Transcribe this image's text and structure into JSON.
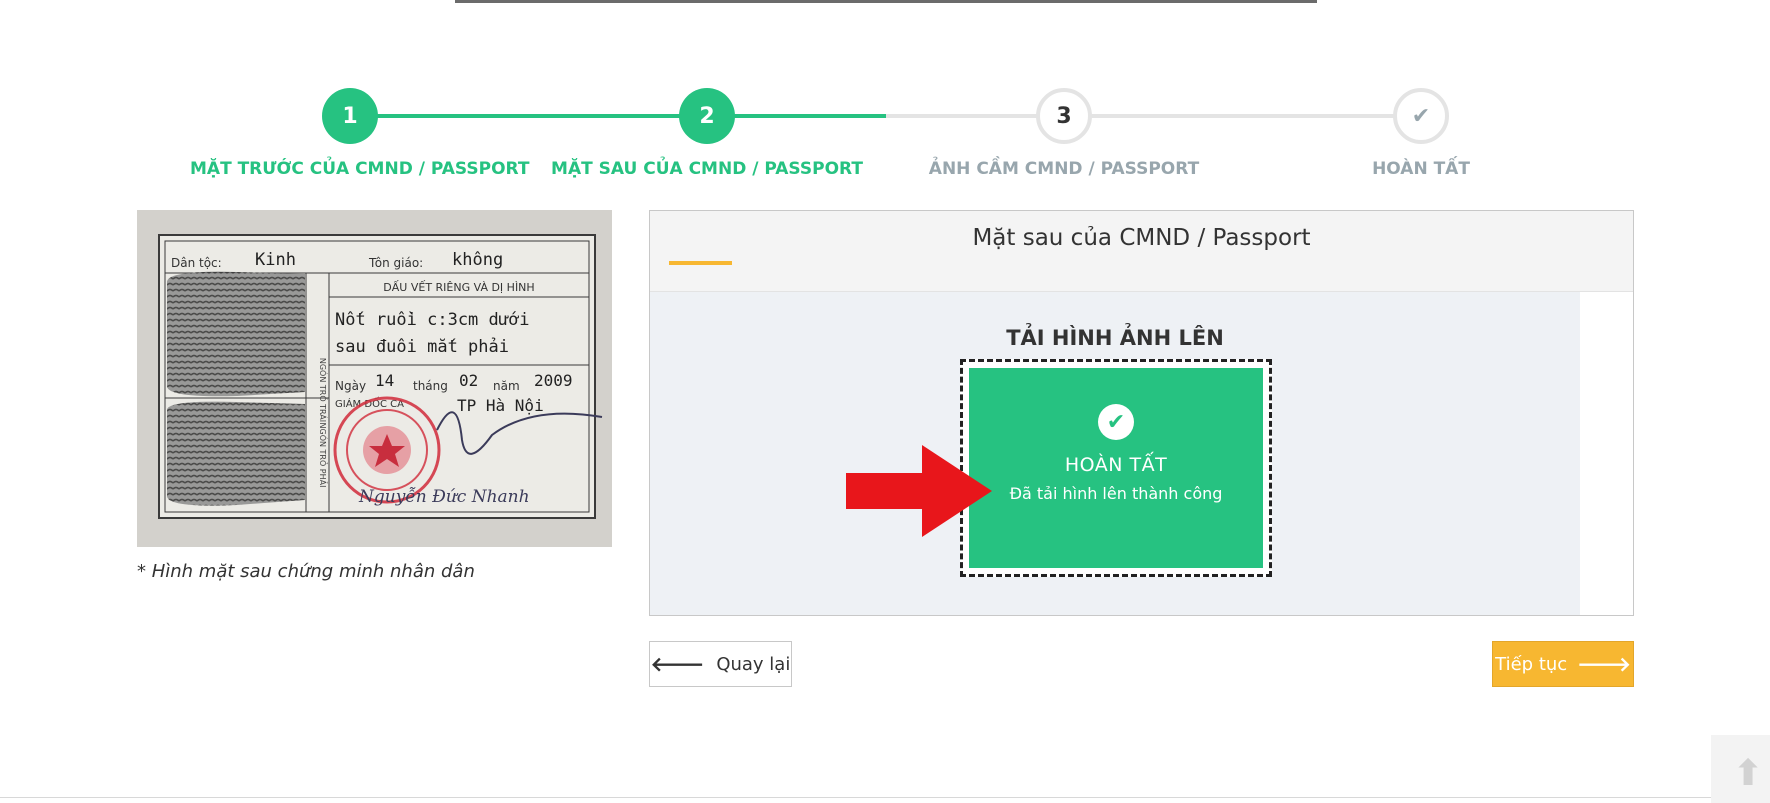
{
  "stepper": {
    "steps": [
      {
        "number": "1",
        "label": "MẶT TRƯỚC CỦA CMND / PASSPORT",
        "state": "done"
      },
      {
        "number": "2",
        "label": "MẶT SAU CỦA CMND / PASSPORT",
        "state": "done"
      },
      {
        "number": "3",
        "label": "ẢNH CẦM CMND / PASSPORT",
        "state": "todo"
      },
      {
        "number": "",
        "label": "HOÀN TẤT",
        "state": "todo",
        "icon": "check-icon"
      }
    ]
  },
  "idcard": {
    "dan_toc_label": "Dân tộc:",
    "dan_toc_value": "Kinh",
    "ton_giao_label": "Tôn giáo:",
    "ton_giao_value": "không",
    "header": "DẤU VẾT RIÊNG VÀ DỊ HÌNH",
    "marks_line1": "Nốt ruồi c:3cm dưới",
    "marks_line2": "sau đuôi mắt phải",
    "date_prefix": "Ngày",
    "date_day": "14",
    "date_month_label": "tháng",
    "date_month": "02",
    "date_year_label": "năm",
    "date_year": "2009",
    "director_label": "GIÁM ĐỐC CA",
    "city": "TP Hà Nội",
    "signer": "Nguyễn Đức Nhanh",
    "left_thumb_label": "NGÓN TRỎ TRÁI",
    "right_thumb_label": "NGÓN TRỎ PHẢI",
    "caption": "* Hình mặt sau chứng minh nhân dân"
  },
  "panel": {
    "title": "Mặt sau của CMND / Passport",
    "upload_heading": "TẢI HÌNH ẢNH LÊN",
    "status_title": "HOÀN TẤT",
    "status_message": "Đã tải hình lên thành công"
  },
  "buttons": {
    "back_label": "Quay lại",
    "next_label": "Tiếp tục"
  },
  "colors": {
    "primary_green": "#26c281",
    "accent_orange": "#f7b731",
    "muted_gray": "#98a6ad",
    "arrow_red": "#e8161b"
  }
}
